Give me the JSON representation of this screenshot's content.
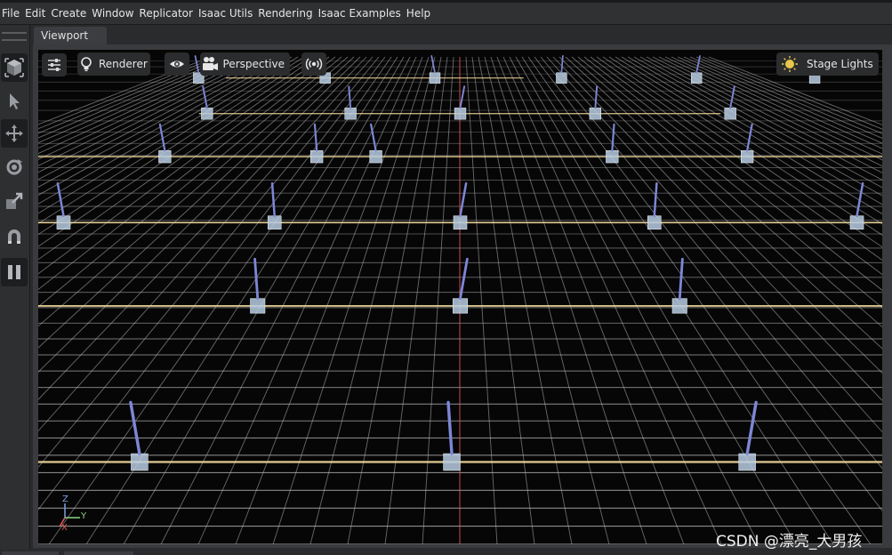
{
  "menubar": {
    "items": [
      "File",
      "Edit",
      "Create",
      "Window",
      "Replicator",
      "Isaac Utils",
      "Rendering",
      "Isaac Examples",
      "Help"
    ]
  },
  "toolbar": {
    "tools": [
      "stage-cube-icon",
      "select-arrow-icon",
      "move-icon",
      "rotate-icon",
      "scale-icon",
      "snap-magnet-icon",
      "pause-icon"
    ]
  },
  "tabs": {
    "viewport": "Viewport"
  },
  "viewport": {
    "renderer_label": "Renderer",
    "camera_label": "Perspective",
    "lights_label": "Stage Lights",
    "axis": {
      "z": "Z",
      "y": "Y",
      "x": "X"
    }
  },
  "watermark": "CSDN @漂亮_大男孩",
  "colors": {
    "menubar": "#303133",
    "viewport_bg": "#060606",
    "grid_line": "#bdbdbd",
    "rail_line": "#f0d79a",
    "axis_red": "#e35a5a",
    "robot_pole": "#7d86d6",
    "robot_base": "#b8cce2",
    "lights_icon": "#e8c64a"
  },
  "scene": {
    "rows": [
      {
        "depth": 0.02,
        "robots": [
          0.19,
          0.34,
          0.47,
          0.62,
          0.78,
          0.92
        ]
      },
      {
        "depth": 0.14,
        "robots": [
          0.2,
          0.37,
          0.5,
          0.66,
          0.82
        ]
      },
      {
        "depth": 0.26,
        "robots": [
          0.15,
          0.33,
          0.4,
          0.68,
          0.84
        ]
      },
      {
        "depth": 0.42,
        "robots": [
          0.03,
          0.28,
          0.5,
          0.73,
          0.97
        ]
      },
      {
        "depth": 0.6,
        "robots": [
          -0.05,
          0.26,
          0.5,
          0.76
        ]
      },
      {
        "depth": 0.9,
        "robots": [
          0.12,
          0.49,
          0.84
        ]
      }
    ]
  }
}
